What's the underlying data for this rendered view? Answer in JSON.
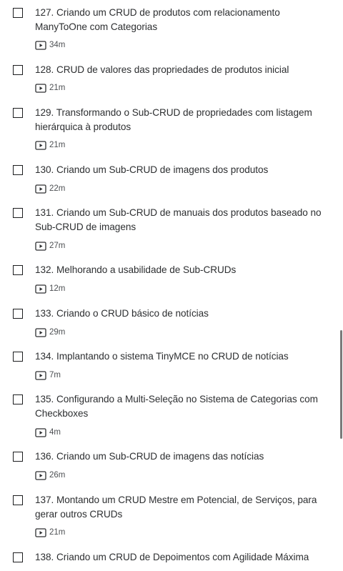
{
  "lectures": [
    {
      "title": "127. Criando um CRUD de produtos com relacionamento ManyToOne com Categorias",
      "duration": "34m"
    },
    {
      "title": "128. CRUD de valores das propriedades de produtos inicial",
      "duration": "21m"
    },
    {
      "title": "129. Transformando o Sub-CRUD de propriedades com listagem hierárquica à produtos",
      "duration": "21m"
    },
    {
      "title": "130. Criando um Sub-CRUD de imagens dos produtos",
      "duration": "22m"
    },
    {
      "title": "131. Criando um Sub-CRUD de manuais dos produtos baseado no Sub-CRUD de imagens",
      "duration": "27m"
    },
    {
      "title": "132. Melhorando a usabilidade de Sub-CRUDs",
      "duration": "12m"
    },
    {
      "title": "133. Criando o CRUD básico de notícias",
      "duration": "29m"
    },
    {
      "title": "134. Implantando o sistema TinyMCE no CRUD de notícias",
      "duration": "7m"
    },
    {
      "title": "135. Configurando a Multi-Seleção no Sistema de Categorias com Checkboxes",
      "duration": "4m"
    },
    {
      "title": "136. Criando um Sub-CRUD de imagens das notícias",
      "duration": "26m"
    },
    {
      "title": "137. Montando um CRUD Mestre em Potencial, de Serviços, para gerar outros CRUDs",
      "duration": "21m"
    },
    {
      "title": "138. Criando um CRUD de Depoimentos com Agilidade Máxima",
      "duration": ""
    }
  ],
  "scroll_fraction": 0.62,
  "colors": {
    "text": "#2d2f31",
    "meta": "#4d5053",
    "checkbox": "#1c1d1f",
    "scrollbar": "#7a7a7a"
  }
}
